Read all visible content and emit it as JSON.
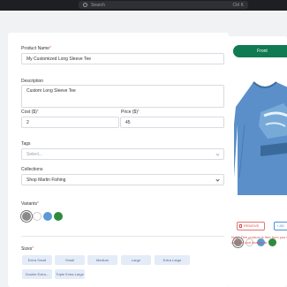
{
  "topbar": {
    "search_placeholder": "Search",
    "shortcut": "Ctrl K"
  },
  "form": {
    "product_name_label": "Product Name",
    "product_name_value": "My Customized Long Sleeve Tee",
    "description_label": "Description",
    "description_value": "Custom Long Sleeve Tee",
    "cost_label": "Cost ($)",
    "cost_value": "2",
    "price_label": "Price ($)",
    "price_value": "45",
    "tags_label": "Tags",
    "tags_placeholder": "Select...",
    "collections_label": "Collections",
    "collections_value": "Shop Martin Fishing",
    "variants_label": "Variants",
    "required_mark": "*",
    "variant_colors": [
      "#8a8a8a",
      "#ffffff",
      "#5b9bd5",
      "#2e8b3e"
    ],
    "sizes_label": "Sizes",
    "sizes": [
      "Extra Small",
      "Small",
      "Medium",
      "Large",
      "Extra Large",
      "Double Extra...",
      "Triple Extra Large"
    ]
  },
  "preview": {
    "front_label": "Front",
    "remove_label": "REMOVE",
    "add_label": "+ AD",
    "swatches": [
      "#8a8a8a",
      "#ffffff",
      "#5b9bd5",
      "#2e8b3e"
    ],
    "shirt_color": "#5b8fc9",
    "note": "Note: This product is free from you to add text and images ar"
  }
}
